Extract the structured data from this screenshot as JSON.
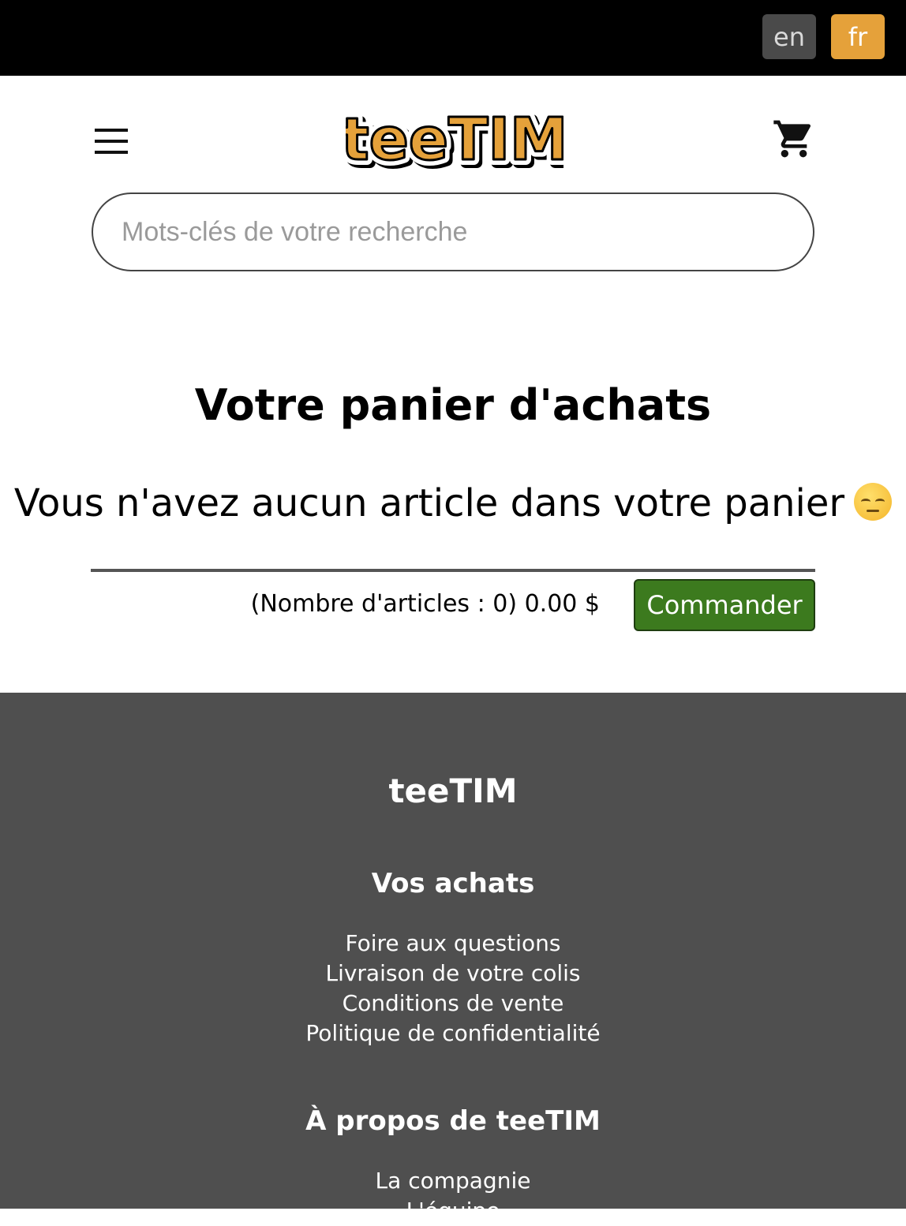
{
  "lang": {
    "en": "en",
    "fr": "fr"
  },
  "header": {
    "logo_text": "teeTIM",
    "search_placeholder": "Mots-clés de votre recherche"
  },
  "cart": {
    "title": "Votre panier d'achats",
    "empty_message": "Vous n'avez aucun article dans votre panier",
    "summary": "(Nombre d'articles : 0) 0.00 $",
    "order_button": "Commander"
  },
  "footer": {
    "brand": "teeTIM",
    "section1_title": "Vos achats",
    "section1_links": [
      "Foire aux questions",
      "Livraison de votre colis",
      "Conditions de vente",
      "Politique de confidentialité"
    ],
    "section2_title": "À propos de teeTIM",
    "section2_links": [
      "La compagnie",
      "L'équipe"
    ]
  },
  "colors": {
    "accent": "#e5a13a",
    "order_button": "#3c7a1e",
    "footer_bg": "#4f4f4f"
  },
  "icons": [
    "menu-icon",
    "cart-icon",
    "sad-face-emoji"
  ]
}
